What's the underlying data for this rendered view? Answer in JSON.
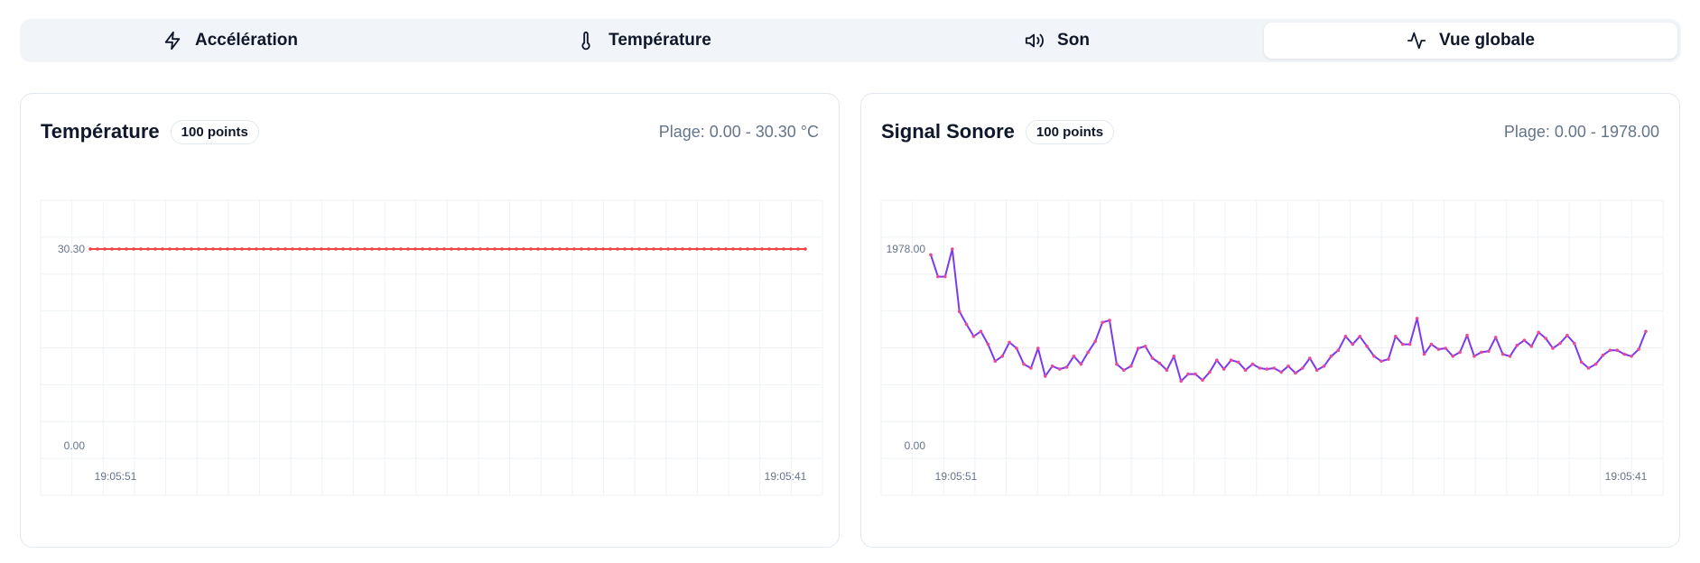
{
  "tabs": [
    {
      "label": "Accélération",
      "icon": "lightning-icon",
      "active": false
    },
    {
      "label": "Température",
      "icon": "thermometer-icon",
      "active": false
    },
    {
      "label": "Son",
      "icon": "speaker-icon",
      "active": false
    },
    {
      "label": "Vue globale",
      "icon": "activity-icon",
      "active": true
    }
  ],
  "cards": {
    "temperature": {
      "title": "Température",
      "badge": "100 points",
      "range": "Plage: 0.00 - 30.30 °C"
    },
    "sound": {
      "title": "Signal Sonore",
      "badge": "100 points",
      "range": "Plage: 0.00 - 1978.00"
    }
  },
  "chart_data": [
    {
      "type": "line",
      "title": "Température",
      "color": "#ef4444",
      "ylim": [
        0,
        30.3
      ],
      "yticks": [
        "30.30",
        "0.00"
      ],
      "xticks": [
        "19:05:51",
        "19:05:41"
      ],
      "grid": true,
      "series": [
        {
          "values": [
            30.3,
            30.3,
            30.3,
            30.3,
            30.3,
            30.3,
            30.3,
            30.3,
            30.3,
            30.3,
            30.3,
            30.3,
            30.3,
            30.3,
            30.3,
            30.3,
            30.3,
            30.3,
            30.3,
            30.3,
            30.3,
            30.3,
            30.3,
            30.3,
            30.3,
            30.3,
            30.3,
            30.3,
            30.3,
            30.3,
            30.3,
            30.3,
            30.3,
            30.3,
            30.3,
            30.3,
            30.3,
            30.3,
            30.3,
            30.3,
            30.3,
            30.3,
            30.3,
            30.3,
            30.3,
            30.3,
            30.3,
            30.3,
            30.3,
            30.3,
            30.3,
            30.3,
            30.3,
            30.3,
            30.3,
            30.3,
            30.3,
            30.3,
            30.3,
            30.3,
            30.3,
            30.3,
            30.3,
            30.3,
            30.3,
            30.3,
            30.3,
            30.3,
            30.3,
            30.3,
            30.3,
            30.3,
            30.3,
            30.3,
            30.3,
            30.3,
            30.3,
            30.3,
            30.3,
            30.3,
            30.3,
            30.3,
            30.3,
            30.3,
            30.3,
            30.3,
            30.3,
            30.3,
            30.3,
            30.3,
            30.3,
            30.3,
            30.3,
            30.3,
            30.3,
            30.3,
            30.3,
            30.3,
            30.3,
            30.3
          ]
        }
      ]
    },
    {
      "type": "line",
      "title": "Signal Sonore",
      "color": "#7c3aed",
      "marker_color": "#ec4899",
      "ylim": [
        0,
        1978
      ],
      "yticks": [
        "1978.00",
        "0.00"
      ],
      "xticks": [
        "19:05:51",
        "19:05:41"
      ],
      "grid": true,
      "series": [
        {
          "values": [
            1920,
            1700,
            1700,
            1978,
            1350,
            1220,
            1100,
            1150,
            1020,
            850,
            900,
            1040,
            980,
            820,
            780,
            980,
            700,
            800,
            770,
            790,
            900,
            820,
            940,
            1050,
            1240,
            1260,
            820,
            760,
            800,
            980,
            1000,
            880,
            830,
            760,
            900,
            650,
            720,
            720,
            660,
            740,
            860,
            770,
            860,
            840,
            760,
            820,
            780,
            770,
            780,
            740,
            800,
            730,
            780,
            880,
            760,
            800,
            900,
            960,
            1100,
            1020,
            1100,
            1000,
            900,
            850,
            870,
            1100,
            1020,
            1020,
            1280,
            920,
            1020,
            970,
            980,
            900,
            940,
            1110,
            900,
            940,
            950,
            1090,
            920,
            900,
            1010,
            1060,
            1000,
            1140,
            1080,
            980,
            1030,
            1110,
            1030,
            840,
            780,
            820,
            910,
            960,
            960,
            920,
            900,
            970,
            1150
          ]
        }
      ]
    }
  ]
}
